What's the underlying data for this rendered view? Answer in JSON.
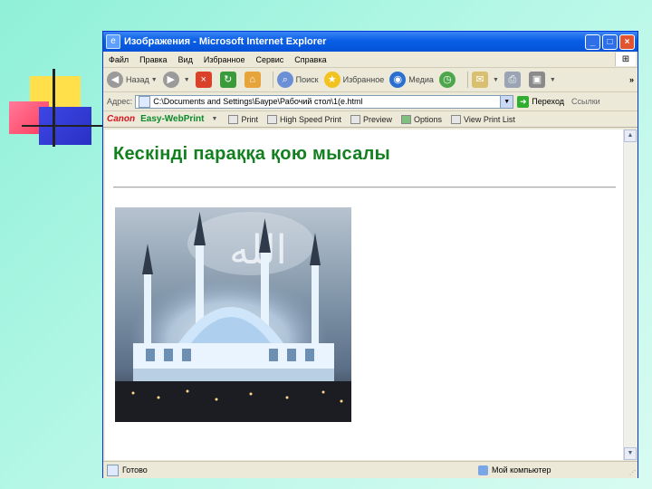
{
  "window": {
    "title": "Изображения - Microsoft Internet Explorer",
    "buttons": {
      "minimize": "_",
      "maximize": "□",
      "close": "×"
    }
  },
  "menu": [
    "Файл",
    "Правка",
    "Вид",
    "Избранное",
    "Сервис",
    "Справка"
  ],
  "toolbar": {
    "back": "Назад",
    "search": "Поиск",
    "favorites": "Избранное",
    "media": "Медиа",
    "overflow": "»"
  },
  "address": {
    "label": "Адрес:",
    "value": "C:\\Documents and Settings\\Бауре\\Рабочий стол\\1(e.html",
    "go": "Переход",
    "links": "Ссылки"
  },
  "canon": {
    "brand": "Canon",
    "product": "Easy-WebPrint",
    "print": "Print",
    "hs_print": "High Speed Print",
    "preview": "Preview",
    "options": "Options",
    "view_list": "View Print List"
  },
  "page": {
    "heading": "Кескінді параққа қою мысалы",
    "picture_text": "الله"
  },
  "status": {
    "text": "Готово",
    "zone": "Мой компьютер"
  },
  "colors": {
    "heading": "#12801f",
    "titlebar": "#0a5ee6",
    "canon_red": "#d4151d",
    "easy_green": "#0c8a2c"
  }
}
